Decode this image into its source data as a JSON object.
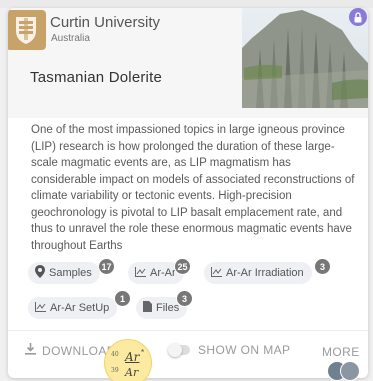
{
  "org": {
    "name": "Curtin University",
    "country": "Australia"
  },
  "title": "Tasmanian Dolerite",
  "abstract": "One of the most impassioned topics in large igneous province (LIP) research is how prolonged the duration of these large-scale magmatic events are, as LIP magmatism has considerable impact on models of associated reconstructions of climate variability or tectonic events. High-precision geochronology is pivotal to LIP basalt emplacement rate, and thus to unravel the role these enormous magmatic events have throughout Earths",
  "chips": [
    {
      "label": "Samples",
      "count": "17",
      "icon": "map-pin-icon"
    },
    {
      "label": "Ar-Ar",
      "count": "25",
      "icon": "chart-icon"
    },
    {
      "label": "Ar-Ar Irradiation",
      "count": "3",
      "icon": "chart-icon"
    },
    {
      "label": "Ar-Ar SetUp",
      "count": "1",
      "icon": "chart-icon"
    },
    {
      "label": "Files",
      "count": "3",
      "icon": "file-icon"
    }
  ],
  "footer": {
    "download_label": "DOWNLOAD",
    "show_on_map_label": "SHOW ON MAP",
    "more_label": "MORE"
  },
  "badge": {
    "mass1": "40",
    "mass2": "39",
    "top": "Ar",
    "bottom": "Ar",
    "star": "*"
  },
  "colors": {
    "logo": "#c7a36a",
    "lock": "#8b7bd8",
    "count": "#777777",
    "badge": "#fbeaa0"
  }
}
